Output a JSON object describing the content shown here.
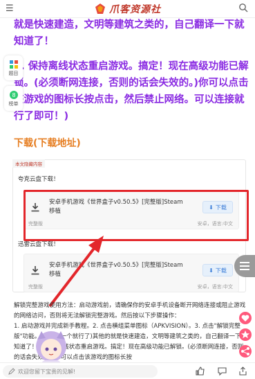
{
  "header": {
    "logo_text": "爪客资源社"
  },
  "intro_lines": [
    "就是快速建造，文明等建筑之类的，自己翻译一下就知道了！",
    "4. 保持离线状态重启游戏。搞定！现在高级功能已解锁。(必须断网连接，否则的话会失效的。)你可以点击该游戏的图标长按点击，然后禁止网络。可以连接就行了即可！)"
  ],
  "side_tools": [
    {
      "label": "题目"
    },
    {
      "label": "榜单"
    }
  ],
  "download_section": {
    "title": "下载(下载地址)",
    "hidden_tag": "本文隐藏内容",
    "cards": [
      {
        "provider": "夸克云盘下载！",
        "file_name": "安卓手机游戏《世界盒子v0.50.5》[完整版]Steam移植",
        "button": "下载",
        "footer": "完整版",
        "meta": "安卓，语言:中文"
      },
      {
        "provider": "迅雷云盘下载！",
        "file_name": "安卓手机游戏《世界盒子v0.50.5》[完整版]Steam移植",
        "button": "下载",
        "footer": "完整版",
        "meta": "安卓，语言:中文"
      }
    ]
  },
  "instructions": [
    "解锁完整游戏使用方法：启动游戏前，请确保你的安卓手机设备断开网络连接或阻止游戏的网络访问，否则将无法解锁完整游戏。然后按以下步骤操作：",
    "1. 启动游戏并完成新手教程。2. 点击横组菜单图标（APKVISION）。3. 点击\"解锁完整版\"功能。(点击第一个就行了)其他的就是快速建造，文明等建筑之类的，自己翻译一下就知道了！4. 保持离线状态重启游戏。搞定！现在高级功能已解锁。(必须断网连接，否则的话会失效的。)你可以点击该游戏的图标长按"
  ],
  "comment_bar": {
    "placeholder": "欢迎您留下宝贵的见解!"
  },
  "colors": {
    "accent_purple": "#8a2be2",
    "download_orange": "#e67e22",
    "highlight_red": "#e3262b",
    "button_blue": "#3b7dd8"
  }
}
